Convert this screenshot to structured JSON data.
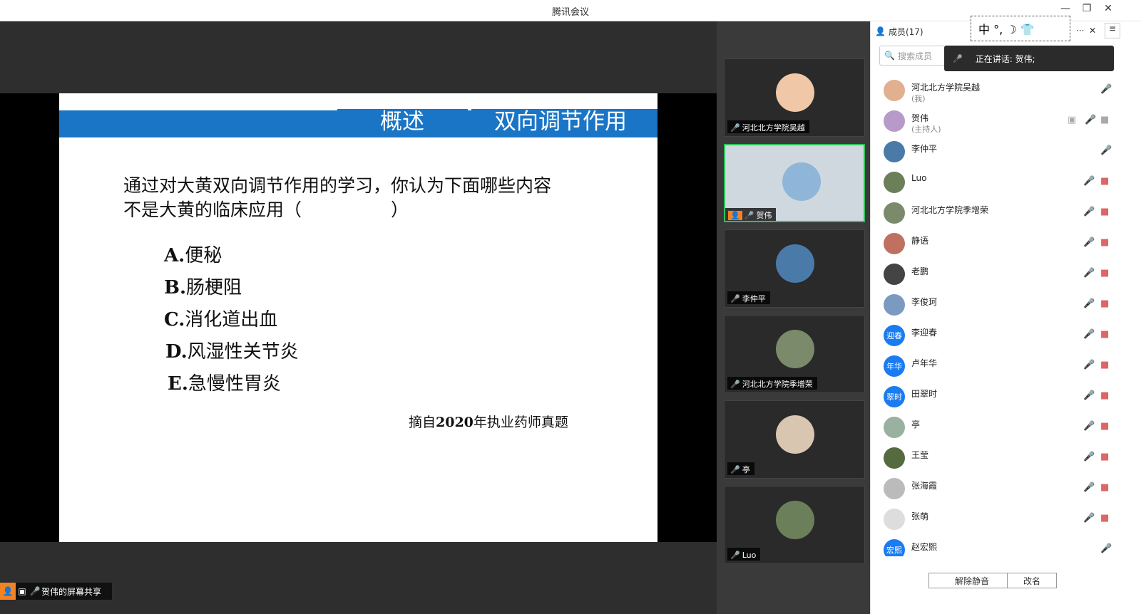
{
  "app": {
    "title": "腾讯会议",
    "minimize": "—",
    "maximize": "❐",
    "close": "✕"
  },
  "slide": {
    "heading1": "概述",
    "heading2": "双向调节作用",
    "question": "通过对大黄双向调节作用的学习，你认为下面哪些内容不是大黄的临床应用（　　　　　）",
    "options": [
      {
        "letter": "A.",
        "text": "便秘"
      },
      {
        "letter": "B.",
        "text": "肠梗阻"
      },
      {
        "letter": "C.",
        "text": "消化道出血"
      },
      {
        "letter": "D.",
        "text": "风湿性关节炎"
      },
      {
        "letter": "E.",
        "text": "急慢性胃炎"
      }
    ],
    "source_prefix": "摘自",
    "source_year": "2020",
    "source_suffix": "年执业药师真题"
  },
  "share_tag": {
    "label": "贺伟的屏幕共享"
  },
  "video_tiles": [
    {
      "name": "河北北方学院吴越",
      "muted": true,
      "color": "#f0c8a8"
    },
    {
      "name": "贺伟",
      "muted": false,
      "active": true,
      "color": "#8fb6d9"
    },
    {
      "name": "李仲平",
      "muted": false,
      "color": "#4a7aa8"
    },
    {
      "name": "河北北方学院季增荣",
      "muted": true,
      "color": "#7a8a6a"
    },
    {
      "name": "亭",
      "muted": true,
      "color": "#d9c6b0"
    },
    {
      "name": "Luo",
      "muted": true,
      "color": "#6b7f5a"
    }
  ],
  "panel": {
    "members_title": "成员(17)",
    "more": "···",
    "close": "✕",
    "search_placeholder": "搜索成员",
    "speaking_prefix": "正在讲话: 贺伟;",
    "ime_text": "中 °, ☽ 👕",
    "unmute_button": "解除静音",
    "rename_button": "改名"
  },
  "members": [
    {
      "name": "河北北方学院吴越",
      "sub": "(我)",
      "avatar_text": "",
      "color": "#e0b090"
    },
    {
      "name": "贺伟",
      "sub": "(主持人)",
      "avatar_text": "",
      "color": "#b89ac8",
      "host": true
    },
    {
      "name": "李仲平",
      "sub": "",
      "avatar_text": "",
      "color": "#4a7aa8"
    },
    {
      "name": "Luo",
      "sub": "",
      "avatar_text": "",
      "color": "#6b7f5a"
    },
    {
      "name": "河北北方学院季增荣",
      "sub": "",
      "avatar_text": "",
      "color": "#7a8a6a"
    },
    {
      "name": "静语",
      "sub": "",
      "avatar_text": "",
      "color": "#c07060"
    },
    {
      "name": "老鹏",
      "sub": "",
      "avatar_text": "",
      "color": "#444444"
    },
    {
      "name": "李俊珂",
      "sub": "",
      "avatar_text": "",
      "color": "#7a9ac0"
    },
    {
      "name": "李迎春",
      "sub": "",
      "avatar_text": "迎春",
      "color": "#1a7cf0"
    },
    {
      "name": "卢年华",
      "sub": "",
      "avatar_text": "年华",
      "color": "#1a7cf0"
    },
    {
      "name": "田翠时",
      "sub": "",
      "avatar_text": "翠时",
      "color": "#1a7cf0"
    },
    {
      "name": "亭",
      "sub": "",
      "avatar_text": "",
      "color": "#9ab0a0"
    },
    {
      "name": "王莹",
      "sub": "",
      "avatar_text": "",
      "color": "#556b3f"
    },
    {
      "name": "张海霞",
      "sub": "",
      "avatar_text": "",
      "color": "#bbbbbb"
    },
    {
      "name": "张萌",
      "sub": "",
      "avatar_text": "",
      "color": "#dddddd"
    },
    {
      "name": "赵宏熙",
      "sub": "",
      "avatar_text": "宏熙",
      "color": "#1a7cf0"
    }
  ]
}
